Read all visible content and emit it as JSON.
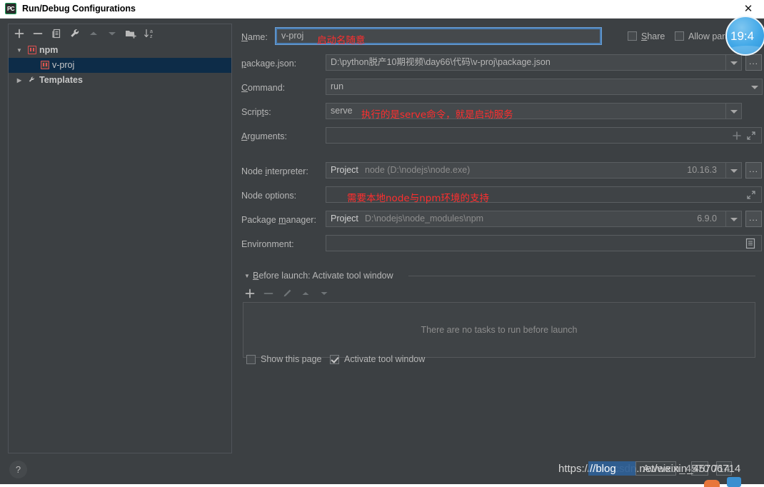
{
  "window": {
    "title": "Run/Debug Configurations",
    "app_icon_label": "PC",
    "close_icon": "close-icon"
  },
  "left_panel": {
    "toolbar": [
      {
        "name": "add-configuration-button",
        "icon": "plus-icon",
        "tooltip": "Add New Configuration"
      },
      {
        "name": "remove-configuration-button",
        "icon": "minus-icon",
        "tooltip": "Remove Configuration"
      },
      {
        "name": "copy-configuration-button",
        "icon": "copy-icon",
        "tooltip": "Copy Configuration"
      },
      {
        "name": "edit-templates-button",
        "icon": "wrench-icon",
        "tooltip": "Edit Templates"
      },
      {
        "name": "move-up-button",
        "icon": "arrow-up-icon",
        "tooltip": "Move Up"
      },
      {
        "name": "move-down-button",
        "icon": "arrow-down-icon",
        "tooltip": "Move Down"
      },
      {
        "name": "new-folder-button",
        "icon": "new-folder-icon",
        "tooltip": "Create New Folder"
      },
      {
        "name": "sort-button",
        "icon": "sort-az-icon",
        "tooltip": "Sort Configurations"
      }
    ],
    "tree": [
      {
        "label": "npm",
        "icon": "npm-icon",
        "expanded": true,
        "selected": false,
        "level": 0,
        "bold": true
      },
      {
        "label": "v-proj",
        "icon": "npm-icon",
        "expanded": null,
        "selected": true,
        "level": 1,
        "bold": false
      },
      {
        "label": "Templates",
        "icon": "wrench-icon",
        "expanded": false,
        "selected": false,
        "level": 0,
        "bold": true
      }
    ]
  },
  "form": {
    "name": {
      "label": "Name:",
      "label_mnemonic": "N",
      "label_rest": "ame:",
      "value": "v-proj",
      "annotation": "启动名随意"
    },
    "share": {
      "label_mnemonic": "S",
      "label_rest": "hare",
      "checked": false
    },
    "allow_parallel": {
      "label": "Allow parallel run",
      "visible_label": "Allow paralle",
      "checked": false
    },
    "package_json": {
      "label": "package.json:",
      "label_mnemonic": "p",
      "value": "D:\\python脱产10期视频\\day66\\代码\\v-proj\\package.json",
      "browse_label": "...",
      "dropdown_icon": "chevron-down-icon"
    },
    "command": {
      "label": "Command:",
      "label_mnemonic": "C",
      "label_rest": "ommand:",
      "value": "run",
      "dropdown_icon": "chevron-down-icon"
    },
    "scripts": {
      "label": "Scripts:",
      "label_mnemonic": "t",
      "value": "serve",
      "annotation": "执行的是serve命令，就是启动服务",
      "dropdown_icon": "chevron-down-icon"
    },
    "arguments": {
      "label": "Arguments:",
      "label_mnemonic": "A",
      "label_rest": "rguments:",
      "value": "",
      "add_icon": "plus-icon",
      "expand_icon": "expand-icon"
    },
    "node_interpreter": {
      "label": "Node interpreter:",
      "label_mnemonic": "i",
      "scope": "Project",
      "value": "node (D:\\nodejs\\node.exe)",
      "version": "10.16.3",
      "browse_label": "...",
      "dropdown_icon": "chevron-down-icon"
    },
    "node_options": {
      "label": "Node options:",
      "value": "",
      "annotation": "需要本地node与npm环境的支持",
      "expand_icon": "expand-icon"
    },
    "package_manager": {
      "label": "Package manager:",
      "label_mnemonic": "m",
      "scope": "Project",
      "value": "D:\\nodejs\\node_modules\\npm",
      "version": "6.9.0",
      "browse_label": "...",
      "dropdown_icon": "chevron-down-icon"
    },
    "environment": {
      "label": "Environment:",
      "value": "",
      "edit_icon": "environment-variables-icon"
    },
    "before_launch": {
      "title_mnemonic": "B",
      "title_rest": "efore launch: Activate tool window",
      "expanded": true,
      "toolbar": [
        {
          "name": "add-task-button",
          "icon": "plus-icon"
        },
        {
          "name": "remove-task-button",
          "icon": "minus-icon"
        },
        {
          "name": "edit-task-button",
          "icon": "pencil-icon"
        },
        {
          "name": "task-move-up-button",
          "icon": "arrow-up-icon"
        },
        {
          "name": "task-move-down-button",
          "icon": "arrow-down-icon"
        }
      ],
      "empty_text": "There are no tasks to run before launch"
    },
    "show_this_page": {
      "label": "Show this page",
      "checked": false
    },
    "activate_tool_window": {
      "label": "Activate tool window",
      "checked": true
    }
  },
  "help_button": {
    "icon": "question-mark-icon",
    "label": "?"
  },
  "overlay": {
    "clock_time": "19:4",
    "watermark_prefix": "https://blog.csdn.net/weixin_45706714",
    "watermark_selected": "//blog",
    "watermark_visible_left": "https:",
    "watermark_visible_right": ".csdn.net/weixin_45706714",
    "watermark_overlap": "t/weixin_457 6714",
    "watermark_overlap_alt": "Aweixin_4570 714"
  },
  "colors": {
    "dialog_bg": "#3c4043",
    "field_bg": "#45494c",
    "focus_border": "#4b7fb5",
    "selection_bg": "#0d2c48",
    "annotation_red": "#ff2e2e",
    "npm_red": "#e05252",
    "text": "#b6b6b6"
  }
}
